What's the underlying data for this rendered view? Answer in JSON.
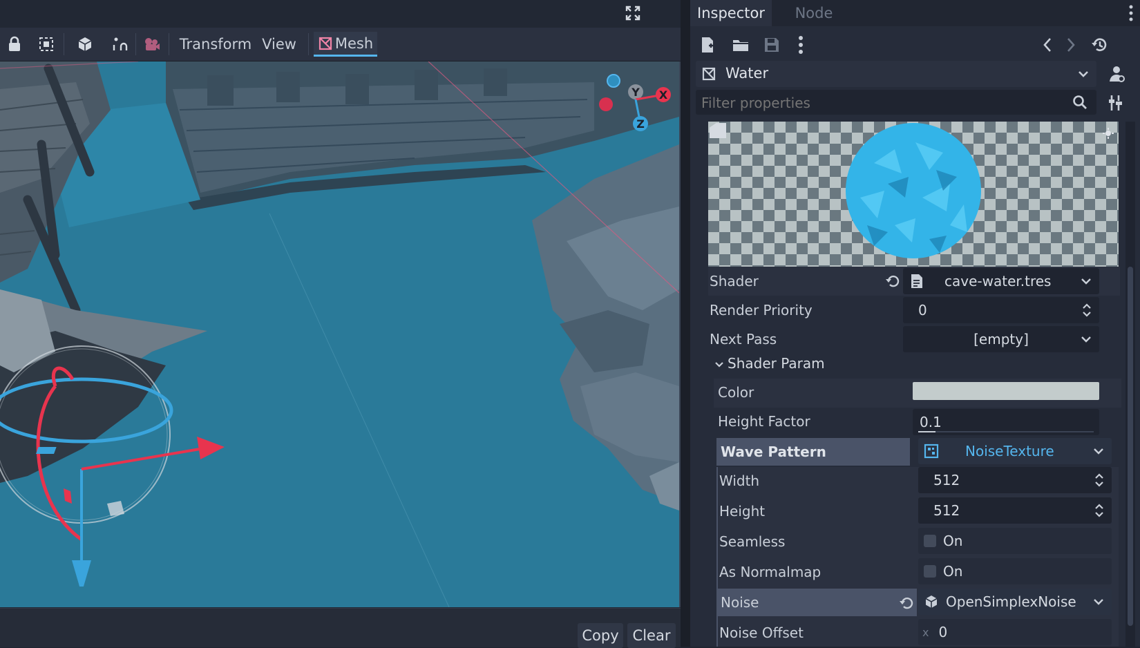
{
  "editor": {
    "toolbar": {
      "transform_label": "Transform",
      "view_label": "View",
      "mesh_label": "Mesh"
    },
    "gizmo": {
      "x": "X",
      "y": "Y",
      "z": "Z"
    },
    "bottom": {
      "copy_label": "Copy",
      "clear_label": "Clear"
    }
  },
  "inspector": {
    "tabs": [
      "Inspector",
      "Node"
    ],
    "resource_name": "Water",
    "filter_placeholder": "Filter properties",
    "properties": {
      "shader": {
        "label": "Shader",
        "value": "cave-water.tres"
      },
      "render_priority": {
        "label": "Render Priority",
        "value": "0"
      },
      "next_pass": {
        "label": "Next Pass",
        "value": "[empty]"
      },
      "shader_param_section": "Shader Param",
      "color": {
        "label": "Color",
        "swatch": "#c3cccc"
      },
      "height_factor": {
        "label": "Height Factor",
        "value": "0.1",
        "fraction": 0.1
      },
      "wave_pattern": {
        "label": "Wave Pattern",
        "value": "NoiseTexture"
      },
      "width": {
        "label": "Width",
        "value": "512"
      },
      "height": {
        "label": "Height",
        "value": "512"
      },
      "seamless": {
        "label": "Seamless",
        "value": "On"
      },
      "as_normalmap": {
        "label": "As Normalmap",
        "value": "On"
      },
      "noise": {
        "label": "Noise",
        "value": "OpenSimplexNoise"
      },
      "noise_offset": {
        "label": "Noise Offset",
        "axis": "x",
        "value": "0"
      }
    }
  },
  "colors": {
    "accent": "#55b6ee",
    "water": "#2a7a99",
    "axis_x": "#e8344e",
    "axis_y": "#8acc48",
    "axis_z": "#3aa4dc"
  }
}
